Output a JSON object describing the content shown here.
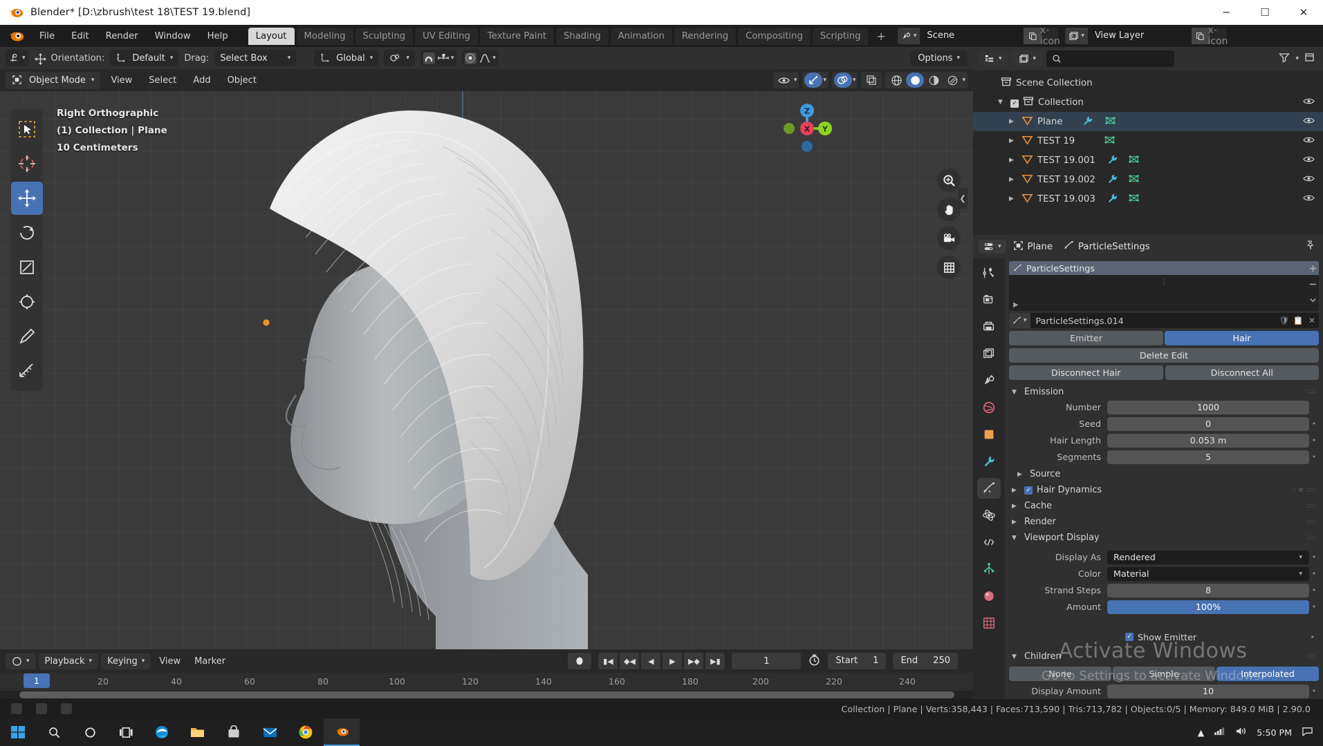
{
  "window": {
    "title": "Blender* [D:\\zbrush\\test 18\\TEST 19.blend]",
    "app_icon": "blender-logo-icon",
    "minimize": "─",
    "maximize": "☐",
    "close": "✕"
  },
  "topbar": {
    "menus": [
      "File",
      "Edit",
      "Render",
      "Window",
      "Help"
    ],
    "workspaces": [
      "Layout",
      "Modeling",
      "Sculpting",
      "UV Editing",
      "Texture Paint",
      "Shading",
      "Animation",
      "Rendering",
      "Compositing",
      "Scripting"
    ],
    "active_workspace": "Layout",
    "add_workspace": "+",
    "scene": {
      "label": "Scene",
      "new_icon": "duplicate-icon",
      "remove_icon": "x-icon"
    },
    "view_layer": {
      "label": "View Layer",
      "new_icon": "duplicate-icon",
      "remove_icon": "x-icon"
    }
  },
  "tool_header": {
    "orientation_label": "Orientation:",
    "orientation_value": "Default",
    "drag_label": "Drag:",
    "drag_value": "Select Box",
    "transform_orientation": "Global",
    "snap_value": "",
    "options_label": "Options"
  },
  "viewport_header": {
    "mode": "Object Mode",
    "menus": [
      "View",
      "Select",
      "Add",
      "Object"
    ],
    "shading_modes": [
      "wireframe",
      "solid",
      "material-preview",
      "rendered"
    ],
    "active_shading": "solid"
  },
  "viewport": {
    "overlay_lines": [
      "Right Orthographic",
      "(1) Collection | Plane",
      "10 Centimeters"
    ],
    "gizmo_axes": [
      "Z",
      "X",
      "Y"
    ],
    "tools": [
      "tweak-select-box-icon",
      "cursor-icon",
      "move-icon",
      "rotate-icon",
      "scale-icon",
      "transform-icon",
      "annotate-icon",
      "measure-icon"
    ],
    "active_tool_index": 2,
    "nav_buttons": [
      "zoom-icon",
      "pan-hand-icon",
      "camera-icon",
      "grid-toggle-icon"
    ]
  },
  "timeline": {
    "menus": [
      "View",
      "Marker"
    ],
    "playback": "Playback",
    "keying": "Keying",
    "current_frame": "1",
    "start_label": "Start",
    "start_value": "1",
    "end_label": "End",
    "end_value": "250",
    "ruler_ticks": [
      "20",
      "40",
      "60",
      "80",
      "100",
      "120",
      "140",
      "160",
      "180",
      "200",
      "220",
      "240"
    ],
    "playhead_label": "1"
  },
  "outliner": {
    "search_placeholder": "",
    "root": "Scene Collection",
    "items": [
      {
        "label": "Collection",
        "indent": 1,
        "type": "collection",
        "checkbox": true,
        "expanded": true,
        "selected": false,
        "modifiers": []
      },
      {
        "label": "Plane",
        "indent": 2,
        "type": "mesh",
        "checkbox": false,
        "expanded": false,
        "selected": true,
        "modifiers": [
          "wrench-icon",
          "mesh-data-icon"
        ]
      },
      {
        "label": "TEST 19",
        "indent": 2,
        "type": "mesh",
        "checkbox": false,
        "expanded": false,
        "selected": false,
        "modifiers": [
          "mesh-data-icon"
        ]
      },
      {
        "label": "TEST 19.001",
        "indent": 2,
        "type": "mesh",
        "checkbox": false,
        "expanded": false,
        "selected": false,
        "modifiers": [
          "wrench-icon",
          "mesh-data-icon"
        ]
      },
      {
        "label": "TEST 19.002",
        "indent": 2,
        "type": "mesh",
        "checkbox": false,
        "expanded": false,
        "selected": false,
        "modifiers": [
          "wrench-icon",
          "mesh-data-icon"
        ]
      },
      {
        "label": "TEST 19.003",
        "indent": 2,
        "type": "mesh",
        "checkbox": false,
        "expanded": false,
        "selected": false,
        "modifiers": [
          "wrench-icon",
          "mesh-data-icon"
        ]
      }
    ]
  },
  "properties": {
    "breadcrumb_object": "Plane",
    "breadcrumb_data": "ParticleSettings",
    "particle_slot": "ParticleSettings",
    "datablock_name": "ParticleSettings.014",
    "type_emitter": "Emitter",
    "type_hair": "Hair",
    "active_type": "Hair",
    "delete_edit": "Delete Edit",
    "disconnect_hair": "Disconnect Hair",
    "disconnect_all": "Disconnect All",
    "emission": {
      "title": "Emission",
      "fields": [
        {
          "label": "Number",
          "value": "1000",
          "style": "slider"
        },
        {
          "label": "Seed",
          "value": "0",
          "style": "slider"
        },
        {
          "label": "Hair Length",
          "value": "0.053 m",
          "style": "slider"
        },
        {
          "label": "Segments",
          "value": "5",
          "style": "slider"
        }
      ],
      "source": "Source"
    },
    "panels": [
      {
        "label": "Hair Dynamics",
        "expanded": false,
        "checkbox": true
      },
      {
        "label": "Cache",
        "expanded": false,
        "checkbox": false
      },
      {
        "label": "Render",
        "expanded": false,
        "checkbox": false
      },
      {
        "label": "Viewport Display",
        "expanded": true,
        "checkbox": false
      }
    ],
    "viewport_display": {
      "display_as_label": "Display As",
      "display_as_value": "Rendered",
      "color_label": "Color",
      "color_value": "Material",
      "strand_steps_label": "Strand Steps",
      "strand_steps_value": "8",
      "amount_label": "Amount",
      "amount_value": "100%",
      "show_emitter_label": "Show Emitter",
      "show_emitter_checked": true
    },
    "children": {
      "title": "Children",
      "options": [
        "None",
        "Simple",
        "Interpolated"
      ],
      "active": "Interpolated",
      "display_amount_label": "Display Amount",
      "display_amount_value": "10"
    }
  },
  "watermark": {
    "line1": "Activate Windows",
    "line2": "Go to Settings to activate Windows."
  },
  "statusbar": {
    "text": "Collection | Plane | Verts:358,443 | Faces:713,590 | Tris:713,782 | Objects:0/5 | Memory: 849.0 MiB | 2.90.0"
  },
  "taskbar": {
    "items": [
      "start-windows-icon",
      "search-icon",
      "cortana-icon",
      "task-view-icon",
      "edge-icon",
      "file-explorer-icon",
      "store-icon",
      "mail-icon",
      "chrome-icon",
      "blender-icon"
    ],
    "active_index": 9,
    "tray": [
      "chevron-up-icon",
      "network-icon",
      "volume-icon"
    ],
    "clock": "5:50 PM",
    "notification": "notification-icon"
  },
  "colors": {
    "accent_blue": "#4772b3",
    "panel_bg": "#303030",
    "header_bg": "#282828",
    "viewport_bg": "#3a3a3a",
    "orange_mesh": "#e08a3c"
  }
}
